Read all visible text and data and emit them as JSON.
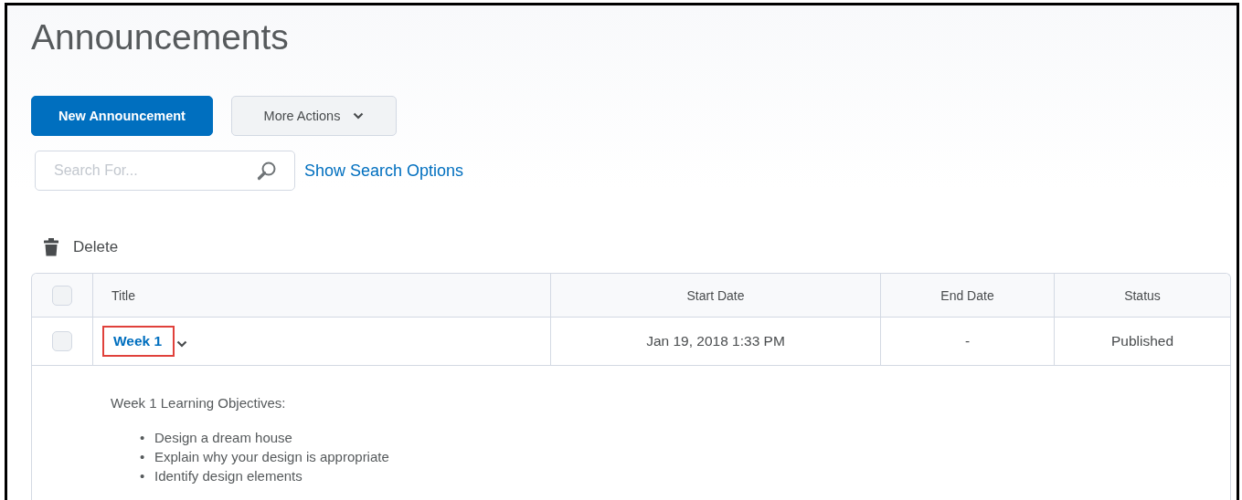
{
  "page_title": "Announcements",
  "buttons": [
    {
      "kind": "primary",
      "label": "New Announcement"
    },
    {
      "kind": "dropdown",
      "label": "More Actions"
    }
  ],
  "search": {
    "placeholder": "Search For...",
    "options_link": "Show Search Options"
  },
  "toolbar": {
    "delete": "Delete"
  },
  "table": {
    "select_all_checked": false,
    "columns": [
      "Title",
      "Start Date",
      "End Date",
      "Status"
    ],
    "rows": [
      {
        "checked": false,
        "title": "Week 1",
        "highlighted": true,
        "start_date": "Jan 19, 2018 1:33 PM",
        "end_date": "-",
        "status": "Published",
        "expanded": true,
        "body": {
          "heading": "Week 1 Learning Objectives:",
          "items": [
            {
              "bullet": "•",
              "text": "Design a dream house"
            },
            {
              "bullet": "•",
              "text": "Explain why your design is appropriate"
            },
            {
              "bullet": "•",
              "text": "Identify design elements"
            }
          ]
        }
      }
    ]
  }
}
